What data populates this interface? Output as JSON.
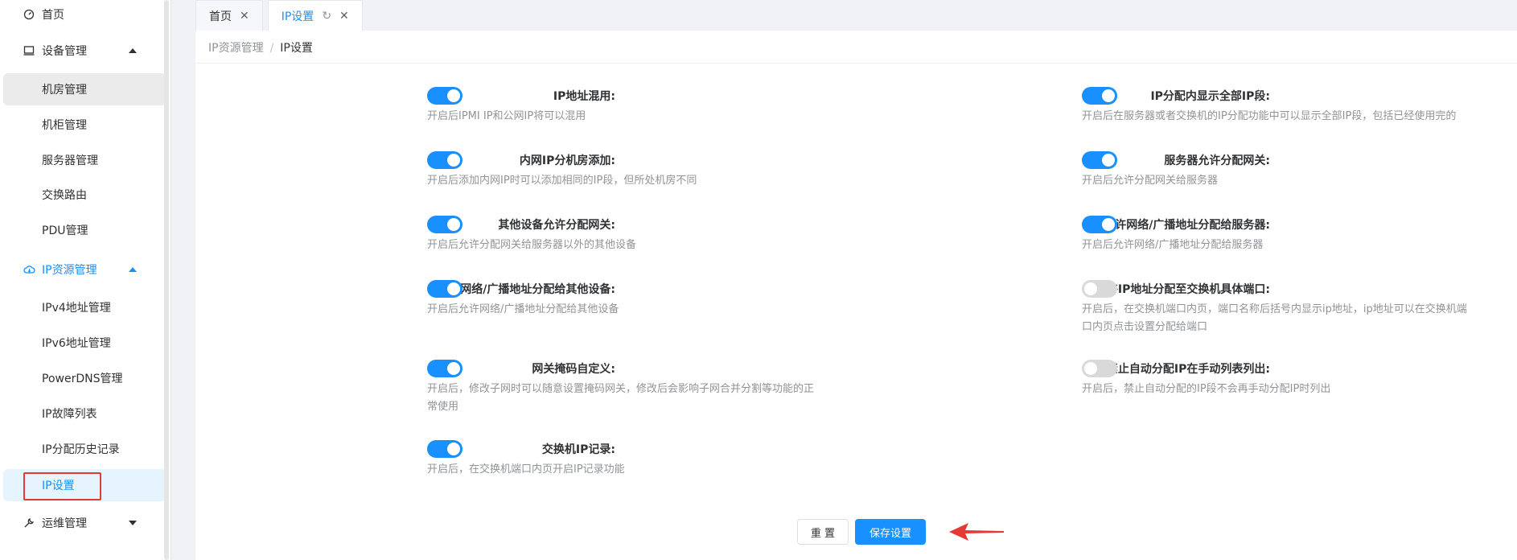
{
  "sidebar": {
    "items": [
      {
        "label": "首页",
        "icon": "dashboard-icon"
      },
      {
        "label": "设备管理",
        "icon": "monitor-icon",
        "expanded": true
      },
      {
        "label": "机房管理",
        "sub": true
      },
      {
        "label": "机柜管理",
        "sub": true
      },
      {
        "label": "服务器管理",
        "sub": true
      },
      {
        "label": "交换路由",
        "sub": true
      },
      {
        "label": "PDU管理",
        "sub": true
      },
      {
        "label": "IP资源管理",
        "icon": "cloud-icon",
        "expanded": true
      },
      {
        "label": "IPv4地址管理",
        "sub": true
      },
      {
        "label": "IPv6地址管理",
        "sub": true
      },
      {
        "label": "PowerDNS管理",
        "sub": true
      },
      {
        "label": "IP故障列表",
        "sub": true
      },
      {
        "label": "IP分配历史记录",
        "sub": true
      },
      {
        "label": "IP设置",
        "sub": true,
        "selected": true
      },
      {
        "label": "运维管理",
        "icon": "wrench-icon",
        "expanded": false
      }
    ]
  },
  "tabs": [
    {
      "label": "首页",
      "active": false
    },
    {
      "label": "IP设置",
      "active": true
    }
  ],
  "breadcrumb": {
    "parent": "IP资源管理",
    "separator": "/",
    "current": "IP设置"
  },
  "settings": {
    "left": [
      {
        "label": "IP地址混用:",
        "enabled": true,
        "desc": [
          "开启后IPMI IP和公网IP将可以混用"
        ]
      },
      {
        "label": "内网IP分机房添加:",
        "enabled": true,
        "desc": [
          "开启后添加内网IP时可以添加相同的IP段，但所处机房不同"
        ]
      },
      {
        "label": "其他设备允许分配网关:",
        "enabled": true,
        "desc": [
          "开启后允许分配网关给服务器以外的其他设备"
        ]
      },
      {
        "label": "允许网络/广播地址分配给其他设备:",
        "enabled": true,
        "desc": [
          "开启后允许网络/广播地址分配给其他设备"
        ]
      },
      {
        "label": "网关掩码自定义:",
        "enabled": true,
        "desc": [
          "开启后，修改子网时可以随意设置掩码网关，修改后会影响子网合并分割等功能的正",
          "常使用"
        ]
      },
      {
        "label": "交换机IP记录:",
        "enabled": true,
        "desc": [
          "开启后，在交换机端口内页开启IP记录功能"
        ]
      }
    ],
    "right": [
      {
        "label": "IP分配内显示全部IP段:",
        "enabled": true,
        "desc": [
          "开启后在服务器或者交换机的IP分配功能中可以显示全部IP段，包括已经使用完的"
        ]
      },
      {
        "label": "服务器允许分配网关:",
        "enabled": true,
        "desc": [
          "开启后允许分配网关给服务器"
        ]
      },
      {
        "label": "允许网络/广播地址分配给服务器:",
        "enabled": true,
        "desc": [
          "开启后允许网络/广播地址分配给服务器"
        ]
      },
      {
        "label": "允许IP地址分配至交换机具体端口:",
        "enabled": false,
        "desc": [
          "开启后，在交换机端口内页，端口名称后括号内显示ip地址，ip地址可以在交换机端",
          "口内页点击设置分配给端口"
        ]
      },
      {
        "label": "禁止自动分配IP在手动列表列出:",
        "enabled": false,
        "desc": [
          "开启后，禁止自动分配的IP段不会再手动分配IP时列出"
        ]
      }
    ]
  },
  "buttons": {
    "reset": "重 置",
    "save": "保存设置"
  },
  "colors": {
    "primary": "#1890ff",
    "annotation": "#e53935"
  }
}
